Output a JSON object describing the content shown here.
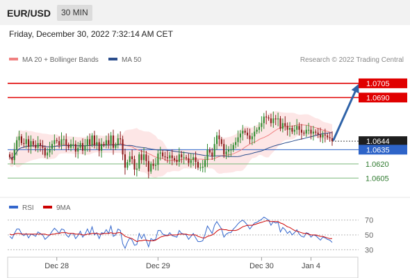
{
  "header": {
    "pair": "EUR/USD",
    "timeframe": "30 MIN",
    "datetime": "Friday, December 30, 2022 7:32:14 AM CET"
  },
  "legend": {
    "ma20_label": "MA 20 + Bollinger Bands",
    "ma50_label": "MA 50",
    "credit": "Research © 2022 Trading Central"
  },
  "colors": {
    "ma20": "#f08080",
    "ma50": "#2b4d8c",
    "resistance": "#e00000",
    "support": "#7ab87a",
    "pivot": "#2e64c8",
    "arrow": "#2f63a8",
    "band": "#fde6e6",
    "up": "#2e8b2e",
    "down": "#8b1a1a",
    "rsi": "#3366cc",
    "rsi_ma": "#cc0000"
  },
  "chart_data": [
    {
      "type": "candlestick",
      "title": "EUR/USD",
      "timeframe": "30 MIN",
      "x_ticks": [
        "Dec 28",
        "Dec 29",
        "Dec 30",
        "Jan 4"
      ],
      "ylim": [
        1.0592,
        1.0724
      ],
      "levels": [
        {
          "value": 1.0705,
          "label": "1.0705",
          "kind": "resistance"
        },
        {
          "value": 1.069,
          "label": "1.0690",
          "kind": "resistance"
        },
        {
          "value": 1.0644,
          "label": "1.0644",
          "kind": "last"
        },
        {
          "value": 1.0635,
          "label": "1.0635",
          "kind": "pivot"
        },
        {
          "value": 1.062,
          "label": "1.0620",
          "kind": "support"
        },
        {
          "value": 1.0605,
          "label": "1.0605",
          "kind": "support"
        }
      ],
      "series": [
        {
          "name": "MA 20 + Bollinger Bands"
        },
        {
          "name": "MA 50"
        }
      ],
      "close": [
        1.0627,
        1.0624,
        1.0635,
        1.0645,
        1.0649,
        1.0642,
        1.0641,
        1.0646,
        1.0638,
        1.0644,
        1.064,
        1.0637,
        1.0642,
        1.0639,
        1.0637,
        1.0629,
        1.0632,
        1.0636,
        1.0641,
        1.0645,
        1.0644,
        1.064,
        1.0646,
        1.0646,
        1.064,
        1.0637,
        1.0641,
        1.0641,
        1.0633,
        1.0637,
        1.0642,
        1.0634,
        1.0639,
        1.0646,
        1.064,
        1.065,
        1.064,
        1.0643,
        1.0634,
        1.0641,
        1.064,
        1.0645,
        1.0641,
        1.065,
        1.0637,
        1.064,
        1.0647,
        1.0646,
        1.063,
        1.0616,
        1.0622,
        1.0628,
        1.0625,
        1.0614,
        1.0615,
        1.063,
        1.0624,
        1.063,
        1.0623,
        1.0612,
        1.062,
        1.0618,
        1.0619,
        1.0631,
        1.0632,
        1.0628,
        1.0627,
        1.0626,
        1.0629,
        1.0626,
        1.0624,
        1.0622,
        1.063,
        1.0627,
        1.0627,
        1.0626,
        1.0621,
        1.0624,
        1.0627,
        1.0622,
        1.0616,
        1.0616,
        1.0617,
        1.0624,
        1.0635,
        1.0632,
        1.0628,
        1.0641,
        1.065,
        1.0646,
        1.0641,
        1.063,
        1.0633,
        1.0635,
        1.0635,
        1.064,
        1.0643,
        1.0648,
        1.0652,
        1.0655,
        1.0653,
        1.065,
        1.0646,
        1.0649,
        1.0654,
        1.0656,
        1.0659,
        1.0663,
        1.067,
        1.0669,
        1.0668,
        1.0663,
        1.0668,
        1.0667,
        1.0668,
        1.0657,
        1.0663,
        1.066,
        1.0656,
        1.0658,
        1.0654,
        1.0656,
        1.066,
        1.0656,
        1.0653,
        1.0652,
        1.0656,
        1.0656,
        1.0652,
        1.0654,
        1.0653,
        1.0651,
        1.0648,
        1.0651,
        1.065,
        1.0648,
        1.0647,
        1.0644
      ],
      "x_tick_index": [
        20,
        63,
        107,
        128
      ]
    },
    {
      "type": "line",
      "title": "RSI",
      "series": [
        {
          "name": "RSI"
        },
        {
          "name": "9MA"
        }
      ],
      "ylim": [
        20,
        80
      ],
      "y_ticks": [
        70,
        50,
        30
      ],
      "x_ticks": [
        "Dec 28",
        "Dec 29",
        "Dec 30",
        "Jan 4"
      ],
      "rsi": [
        48.0,
        45.0,
        52.0,
        58.0,
        58.0,
        52.0,
        49.0,
        52.0,
        46.0,
        51.0,
        50.0,
        48.0,
        54.0,
        52.0,
        50.0,
        44.0,
        47.0,
        50.0,
        55.0,
        59.0,
        56.0,
        52.0,
        58.0,
        57.0,
        50.0,
        47.0,
        52.0,
        52.0,
        45.0,
        49.0,
        55.0,
        47.0,
        51.0,
        58.0,
        51.0,
        61.0,
        50.0,
        53.0,
        45.0,
        53.0,
        52.0,
        57.0,
        52.0,
        62.0,
        48.0,
        50.0,
        58.0,
        56.0,
        38.0,
        32.0,
        40.0,
        46.0,
        43.0,
        36.0,
        37.0,
        52.0,
        45.0,
        51.0,
        43.0,
        34.0,
        45.0,
        43.0,
        44.0,
        56.0,
        56.0,
        51.0,
        50.0,
        49.0,
        53.0,
        49.0,
        48.0,
        47.0,
        56.0,
        52.0,
        51.0,
        50.0,
        44.0,
        48.0,
        52.0,
        46.0,
        41.0,
        41.0,
        42.0,
        51.0,
        62.0,
        57.0,
        52.0,
        63.0,
        68.0,
        63.0,
        58.0,
        47.0,
        51.0,
        53.0,
        53.0,
        58.0,
        61.0,
        65.0,
        68.0,
        70.0,
        67.0,
        63.0,
        58.0,
        62.0,
        66.0,
        67.0,
        69.0,
        71.0,
        74.0,
        72.0,
        70.0,
        63.0,
        68.0,
        66.0,
        67.0,
        54.0,
        60.0,
        57.0,
        52.0,
        55.0,
        50.0,
        53.0,
        57.0,
        51.0,
        48.0,
        47.0,
        53.0,
        52.0,
        47.0,
        50.0,
        49.0,
        46.0,
        43.0,
        47.0,
        46.0,
        44.0,
        43.0,
        40.0
      ],
      "rsi_ma": [
        51.0,
        50.0,
        51.0,
        52.0,
        52.0,
        51.0,
        51.0,
        51.0,
        51.0,
        51.0,
        51.0,
        51.0,
        51.0,
        51.0,
        51.0,
        51.0,
        50.0,
        50.0,
        51.0,
        51.0,
        52.0,
        52.0,
        53.0,
        53.0,
        53.0,
        52.0,
        52.0,
        52.0,
        51.0,
        51.0,
        51.0,
        50.0,
        50.0,
        51.0,
        51.0,
        52.0,
        52.0,
        52.0,
        51.0,
        51.0,
        52.0,
        52.0,
        52.0,
        53.0,
        52.0,
        52.0,
        53.0,
        53.0,
        51.0,
        48.0,
        47.0,
        46.0,
        45.0,
        43.0,
        41.0,
        42.0,
        42.0,
        43.0,
        43.0,
        42.0,
        42.0,
        42.0,
        43.0,
        45.0,
        47.0,
        48.0,
        49.0,
        49.0,
        50.0,
        50.0,
        50.0,
        50.0,
        51.0,
        51.0,
        51.0,
        51.0,
        50.0,
        50.0,
        50.0,
        50.0,
        48.0,
        47.0,
        46.0,
        46.0,
        48.0,
        49.0,
        50.0,
        52.0,
        55.0,
        57.0,
        58.0,
        57.0,
        57.0,
        56.0,
        56.0,
        56.0,
        56.0,
        57.0,
        59.0,
        61.0,
        62.0,
        63.0,
        63.0,
        63.0,
        64.0,
        65.0,
        66.0,
        67.0,
        68.0,
        69.0,
        69.0,
        68.0,
        68.0,
        68.0,
        68.0,
        66.0,
        65.0,
        63.0,
        61.0,
        60.0,
        58.0,
        56.0,
        55.0,
        54.0,
        53.0,
        52.0,
        52.0,
        51.0,
        50.0,
        50.0,
        50.0,
        49.0,
        48.0,
        48.0,
        47.0,
        46.0,
        45.0,
        45.0
      ]
    }
  ]
}
